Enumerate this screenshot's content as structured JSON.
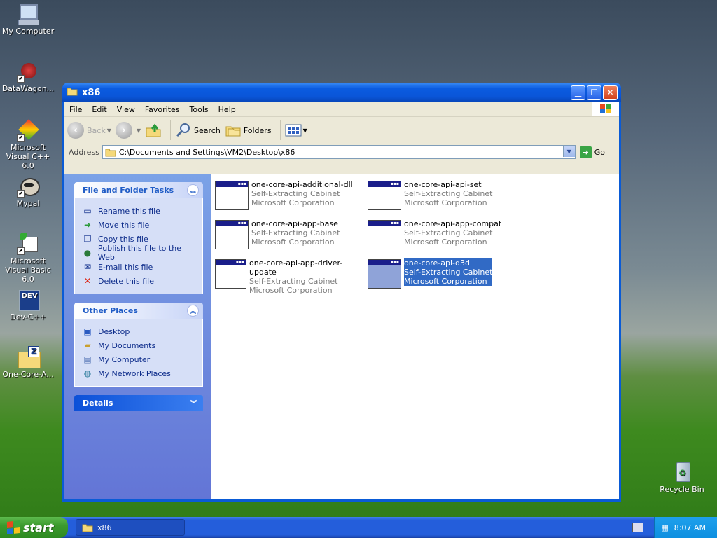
{
  "desktop": {
    "icons": [
      {
        "label": "My Computer"
      },
      {
        "label": "DataWagon..."
      },
      {
        "label": "Microsoft Visual C++ 6.0"
      },
      {
        "label": "Mypal"
      },
      {
        "label": "Microsoft Visual Basic 6.0"
      },
      {
        "label": "Dev-C++"
      },
      {
        "label": "One-Core-A..."
      },
      {
        "label": "Recycle Bin"
      }
    ]
  },
  "window": {
    "title": "x86",
    "menu": [
      "File",
      "Edit",
      "View",
      "Favorites",
      "Tools",
      "Help"
    ],
    "toolbar": {
      "back": "Back",
      "search": "Search",
      "folders": "Folders"
    },
    "address": {
      "label": "Address",
      "value": "C:\\Documents and Settings\\VM2\\Desktop\\x86",
      "go": "Go"
    }
  },
  "tasks_panel": {
    "title": "File and Folder Tasks",
    "items": [
      "Rename this file",
      "Move this file",
      "Copy this file",
      "Publish this file to the Web",
      "E-mail this file",
      "Delete this file"
    ]
  },
  "places_panel": {
    "title": "Other Places",
    "items": [
      "Desktop",
      "My Documents",
      "My Computer",
      "My Network Places"
    ]
  },
  "details_panel": {
    "title": "Details"
  },
  "files": [
    {
      "name": "one-core-api-additional-dll",
      "type": "Self-Extracting Cabinet",
      "company": "Microsoft Corporation",
      "selected": false
    },
    {
      "name": "one-core-api-api-set",
      "type": "Self-Extracting Cabinet",
      "company": "Microsoft Corporation",
      "selected": false
    },
    {
      "name": "one-core-api-app-base",
      "type": "Self-Extracting Cabinet",
      "company": "Microsoft Corporation",
      "selected": false
    },
    {
      "name": "one-core-api-app-compat",
      "type": "Self-Extracting Cabinet",
      "company": "Microsoft Corporation",
      "selected": false
    },
    {
      "name": "one-core-api-app-driver-update",
      "type": "Self-Extracting Cabinet",
      "company": "Microsoft Corporation",
      "selected": false
    },
    {
      "name": "one-core-api-d3d",
      "type": "Self-Extracting Cabinet",
      "company": "Microsoft Corporation",
      "selected": true
    }
  ],
  "taskbar": {
    "start": "start",
    "item": "x86",
    "clock": "8:07 AM"
  }
}
